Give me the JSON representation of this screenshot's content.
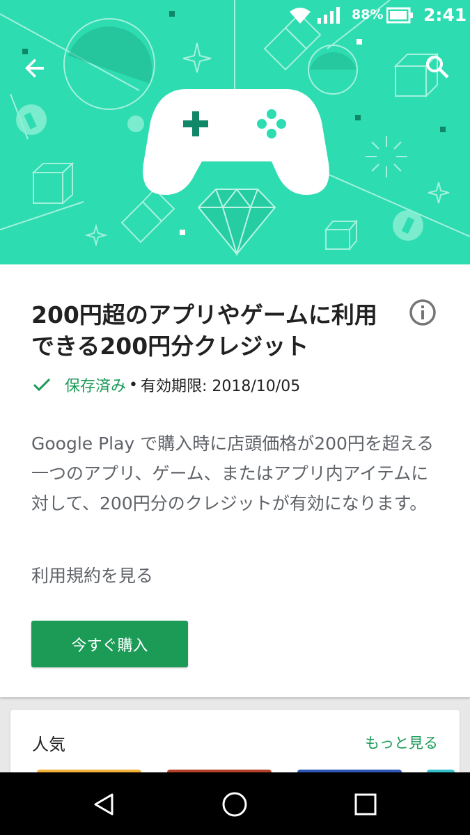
{
  "status_bar": {
    "battery_percent": "88%",
    "time": "2:41"
  },
  "icons": {
    "back": "arrow-back-icon",
    "search": "search-icon",
    "info": "info-icon",
    "check": "check-icon",
    "wifi": "wifi-icon",
    "signal": "cellular-signal-icon",
    "battery": "battery-icon",
    "nav_back": "triangle-back-icon",
    "nav_home": "circle-home-icon",
    "nav_recents": "square-recents-icon"
  },
  "colors": {
    "banner": "#2ddcb0",
    "accent_green": "#1a9a57",
    "button_green": "#1b9b56"
  },
  "offer": {
    "title": "200円超のアプリやゲームに利用できる200円分クレジット",
    "saved_label": "保存済み",
    "separator": "•",
    "expiry": "有効期限: 2018/10/05",
    "description": "Google Play で購入時に店頭価格が200円を超える一つのアプリ、ゲーム、またはアプリ内アイテムに対して、200円分のクレジットが有効になります。",
    "terms_link": "利用規約を見る",
    "buy_button": "今すぐ購入"
  },
  "popular": {
    "heading": "人気",
    "more_link": "もっと見る"
  }
}
